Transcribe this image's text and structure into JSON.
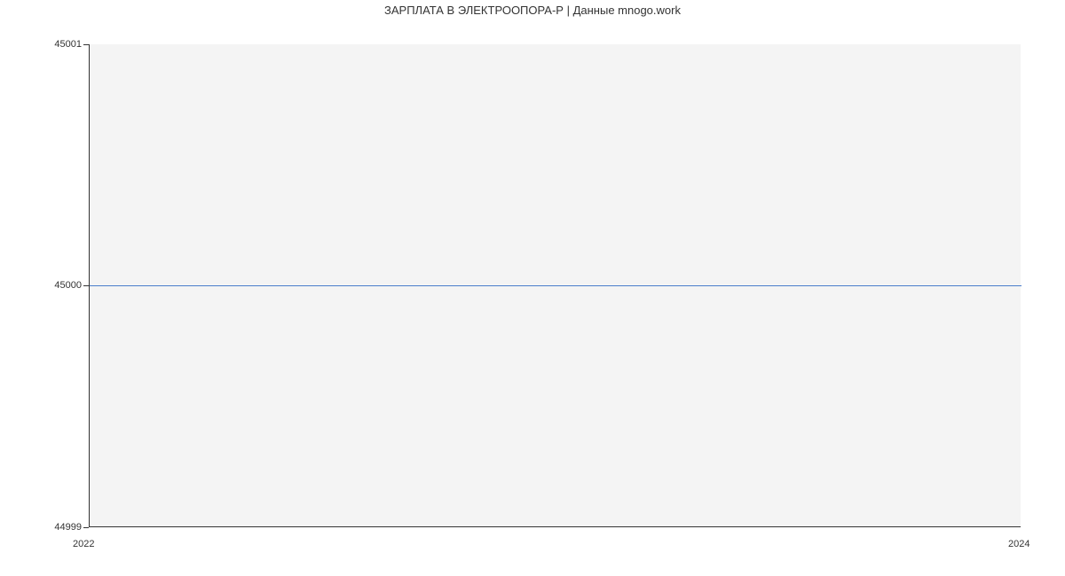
{
  "chart_data": {
    "type": "line",
    "title": "ЗАРПЛАТА В ЭЛЕКТРООПОРА-Р | Данные mnogo.work",
    "xlabel": "",
    "ylabel": "",
    "x": [
      2022,
      2024
    ],
    "values": [
      45000,
      45000
    ],
    "xlim": [
      2022,
      2024
    ],
    "ylim": [
      44999,
      45001
    ],
    "xticks": [
      "2022",
      "2024"
    ],
    "yticks": [
      "44999",
      "45000",
      "45001"
    ]
  }
}
